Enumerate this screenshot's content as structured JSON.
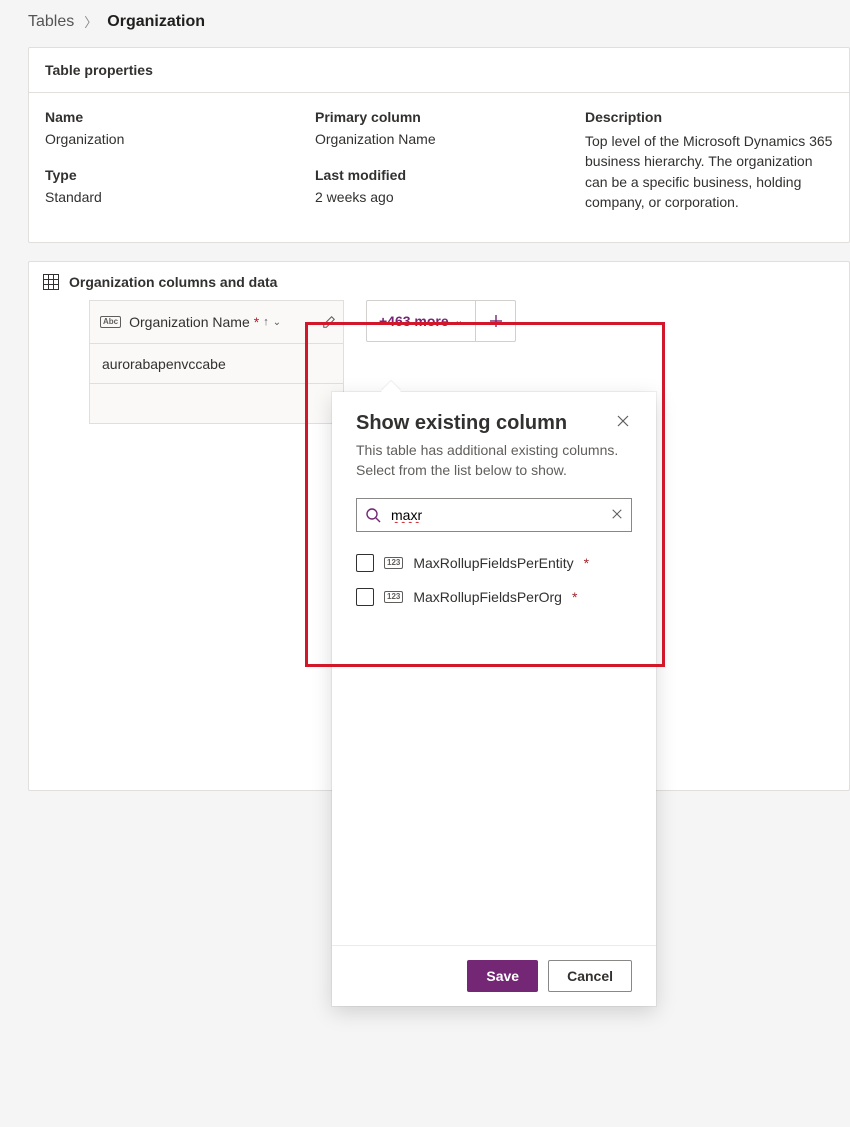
{
  "breadcrumb": {
    "parent": "Tables",
    "current": "Organization"
  },
  "properties_card": {
    "title": "Table properties",
    "name_label": "Name",
    "name_value": "Organization",
    "type_label": "Type",
    "type_value": "Standard",
    "primary_label": "Primary column",
    "primary_value": "Organization Name",
    "modified_label": "Last modified",
    "modified_value": "2 weeks ago",
    "description_label": "Description",
    "description_value": "Top level of the Microsoft Dynamics 365 business hierarchy. The organization can be a specific business, holding company, or corporation."
  },
  "columns_section": {
    "title": "Organization columns and data",
    "col1_label": "Organization Name",
    "col1_type_badge": "Abc",
    "more_label": "+463 more",
    "row1_value": "aurorabapenvccabe"
  },
  "popover": {
    "title": "Show existing column",
    "subtitle": "This table has additional existing columns. Select from the list below to show.",
    "search_value": "maxr",
    "options": [
      {
        "type_badge": "123",
        "label": "MaxRollupFieldsPerEntity"
      },
      {
        "type_badge": "123",
        "label": "MaxRollupFieldsPerOrg"
      }
    ],
    "save_label": "Save",
    "cancel_label": "Cancel"
  }
}
